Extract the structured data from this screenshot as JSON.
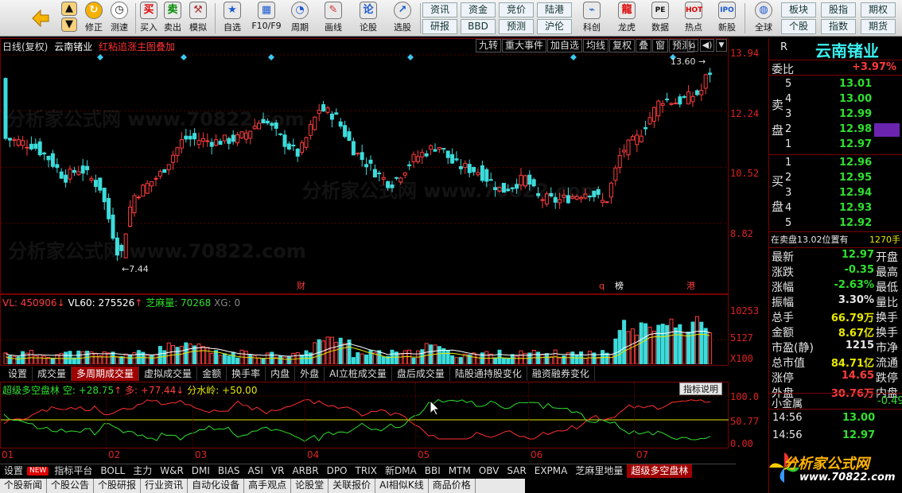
{
  "toolbar": {
    "buttons": [
      "修正",
      "测速",
      "买入",
      "卖出",
      "模拟",
      "自选",
      "F10/F9",
      "周期",
      "画线",
      "论股",
      "选股"
    ],
    "mini": [
      "资讯",
      "资金",
      "竞价",
      "陆港",
      "研报",
      "BBD",
      "预测",
      "沪伦"
    ],
    "right_buttons": [
      "科创",
      "龙虎",
      "数据",
      "热点",
      "新股",
      "全球"
    ],
    "right_mini": [
      "板块",
      "股指",
      "期权",
      "个股",
      "指数",
      "期货"
    ]
  },
  "chart_header": {
    "period": "日线(复权)",
    "stock": "云南锗业",
    "overlay": "红粘追涨主图叠加",
    "buttons": [
      "九转",
      "重大事件",
      "加自选",
      "均线",
      "复权",
      "叠",
      "窗",
      "预测"
    ]
  },
  "price_axis": [
    "13.94",
    "12.24",
    "10.52",
    "8.82"
  ],
  "price_marks": {
    "high": "13.60",
    "low": "7.44"
  },
  "event_marks": [
    "财",
    "q",
    "榜",
    "港"
  ],
  "volume": {
    "vl_label": "VL: 450906",
    "vl60_label": "VL60: 275526",
    "zmv_label": "芝麻量: 70268",
    "xg_label": "XG: 0",
    "axis": [
      "10253",
      "5127",
      "X100"
    ]
  },
  "mid_tabs": [
    "设置",
    "成交量",
    "多周期成交量",
    "虚拟成交量",
    "金额",
    "换手率",
    "内盘",
    "外盘",
    "AI立桩成交量",
    "盘后成交量",
    "陆股通持股变化",
    "融资融券变化"
  ],
  "indicator": {
    "name": "超级多空盘林",
    "kong": "空: +28.75",
    "duo": "多: +77.44",
    "fsl": "分水岭: +50.00",
    "help": "指标说明",
    "axis": [
      "100.0",
      "50.77",
      "0.00"
    ]
  },
  "date_axis": [
    "01",
    "02",
    "03",
    "04",
    "05",
    "06",
    "07"
  ],
  "bottom_tabs": [
    "设置",
    "指标平台",
    "BOLL",
    "主力",
    "W&R",
    "DMI",
    "BIAS",
    "ASI",
    "VR",
    "ARBR",
    "DPO",
    "TRIX",
    "新DMA",
    "BBI",
    "MTM",
    "OBV",
    "SAR",
    "EXPMA",
    "芝麻里地量",
    "超级多空盘林"
  ],
  "new_badge": "NEW",
  "news_tabs": [
    "个股新闻",
    "个股公告",
    "个股研报",
    "行业资讯",
    "自动化设备",
    "高手观点",
    "论股堂",
    "关联报价",
    "AI相似K线",
    "商品价格"
  ],
  "quote": {
    "name": "云南锗业",
    "letter": "R",
    "wei_bi_label": "委比",
    "wei_bi": "+3.97%",
    "sell_label": "卖盘",
    "buy_label": "买盘",
    "sells": [
      {
        "n": "5",
        "p": "13.01"
      },
      {
        "n": "4",
        "p": "13.00"
      },
      {
        "n": "3",
        "p": "12.99"
      },
      {
        "n": "2",
        "p": "12.98"
      },
      {
        "n": "1",
        "p": "12.97"
      }
    ],
    "buys": [
      {
        "n": "1",
        "p": "12.96"
      },
      {
        "n": "2",
        "p": "12.95"
      },
      {
        "n": "3",
        "p": "12.94"
      },
      {
        "n": "4",
        "p": "12.93"
      },
      {
        "n": "5",
        "p": "12.92"
      }
    ],
    "zaimai": "在卖盘13.02位置有",
    "zaimai_vol": "1270手",
    "stats": [
      {
        "k": "最新",
        "v": "12.97",
        "c": "grn",
        "k2": "开盘"
      },
      {
        "k": "涨跌",
        "v": "-0.35",
        "c": "grn",
        "k2": "最高"
      },
      {
        "k": "涨幅",
        "v": "-2.63%",
        "c": "grn",
        "k2": "最低"
      },
      {
        "k": "振幅",
        "v": "3.30%",
        "c": "wht",
        "k2": "量比"
      },
      {
        "k": "总手",
        "v": "66.79万",
        "c": "yel",
        "k2": "换手"
      },
      {
        "k": "金额",
        "v": "8.67亿",
        "c": "yel",
        "k2": "换手"
      },
      {
        "k": "市盈(静)",
        "v": "1215",
        "c": "wht",
        "k2": "市净"
      },
      {
        "k": "总市值",
        "v": "84.71亿",
        "c": "yel",
        "k2": "流通"
      },
      {
        "k": "涨停",
        "v": "14.65",
        "c": "red",
        "k2": "跌停"
      },
      {
        "k": "外盘",
        "v": "30.76万",
        "c": "red",
        "k2": "内盘"
      }
    ],
    "xiaojinshu": "小金属",
    "xiaojinshu_chg": "-0.49",
    "ticks": [
      {
        "t": "14:56",
        "p": "13.00"
      },
      {
        "t": "14:56",
        "p": "12.97"
      }
    ]
  },
  "brand": {
    "name": "分析家公式网",
    "url": "www.70822.com"
  },
  "chart_data": {
    "type": "candlestick",
    "price_axis_ticks": [
      13.94,
      12.24,
      10.52,
      8.82
    ],
    "annotated_high": 13.6,
    "annotated_low": 7.44,
    "volume_axis_ticks": [
      10253,
      5127
    ],
    "indicator_axis_ticks": [
      100.0,
      50.77,
      0.0
    ],
    "indicator_last": {
      "kong": 28.75,
      "duo": 77.44,
      "fenshuiling": 50.0
    },
    "volume_last": {
      "vl": 450906,
      "vl60": 275526,
      "zhimaliang": 70268,
      "xg": 0
    }
  }
}
